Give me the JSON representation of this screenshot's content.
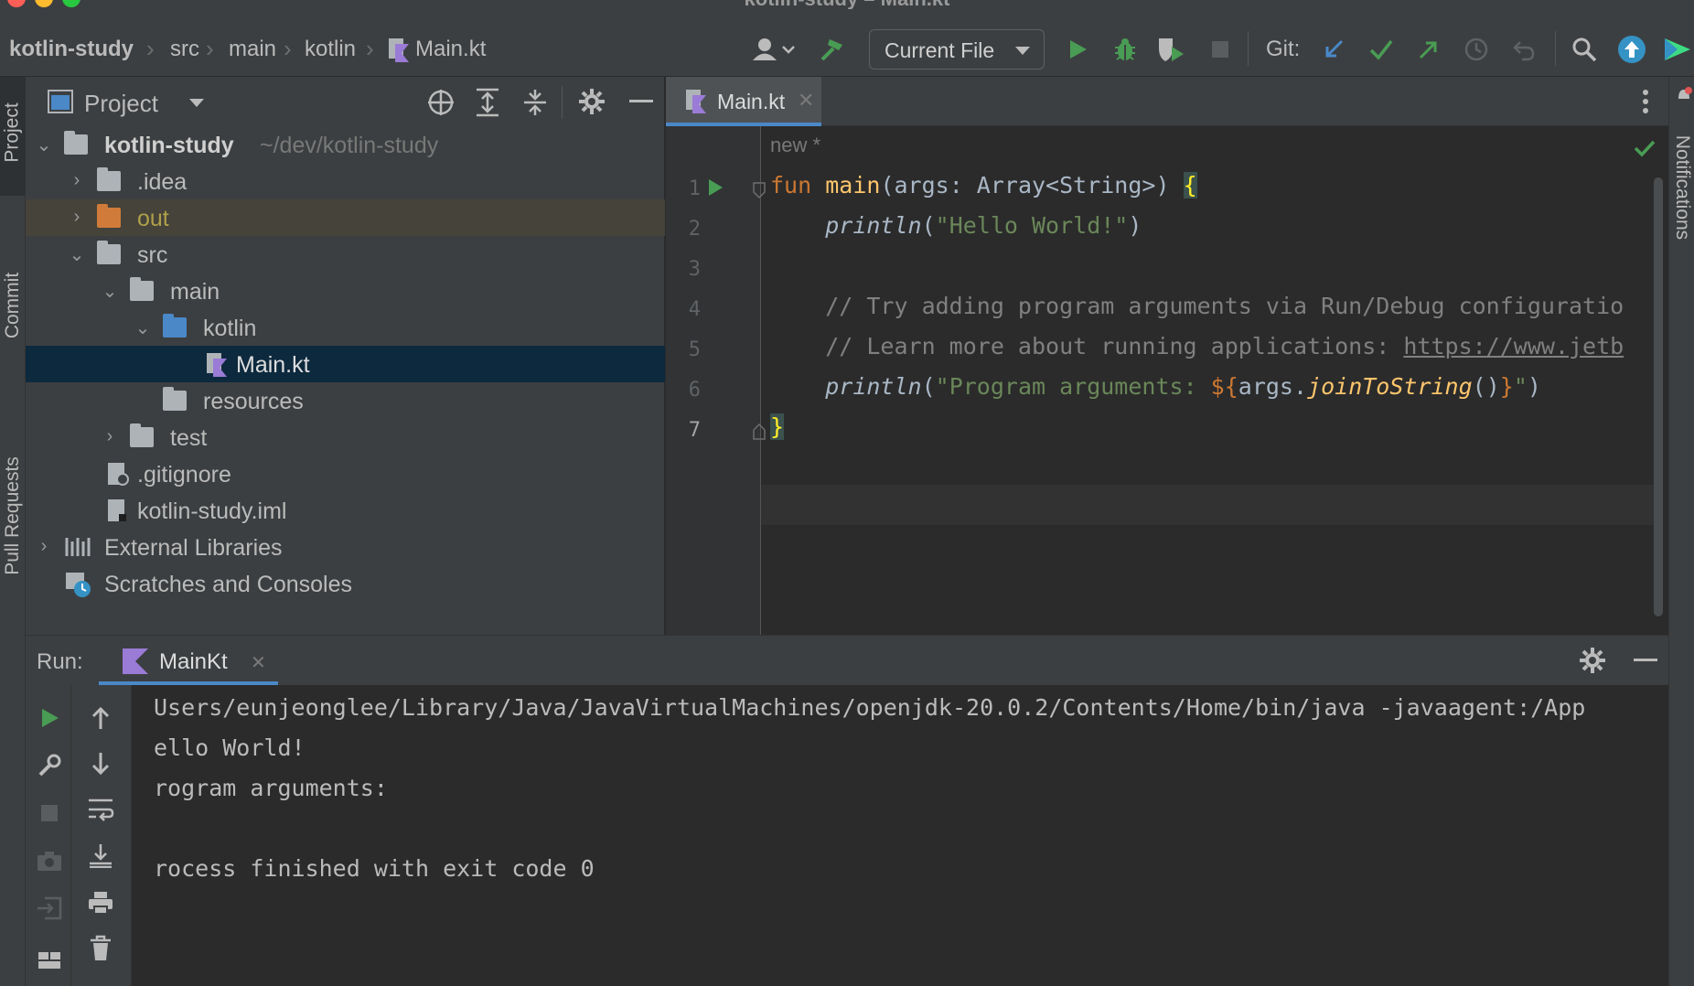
{
  "window": {
    "title": "kotlin-study – Main.kt"
  },
  "breadcrumbs": [
    "kotlin-study",
    "src",
    "main",
    "kotlin",
    "Main.kt"
  ],
  "toolbar": {
    "run_config": "Current File",
    "git_label": "Git:"
  },
  "left_strip": {
    "tabs": [
      "Project",
      "Commit",
      "Pull Requests"
    ]
  },
  "right_strip": {
    "tabs": [
      "Notifications"
    ]
  },
  "project": {
    "title": "Project",
    "root": {
      "name": "kotlin-study",
      "path": "~/dev/kotlin-study"
    },
    "items": [
      {
        "label": ".idea"
      },
      {
        "label": "out"
      },
      {
        "label": "src"
      },
      {
        "label": "main"
      },
      {
        "label": "kotlin"
      },
      {
        "label": "Main.kt"
      },
      {
        "label": "resources"
      },
      {
        "label": "test"
      },
      {
        "label": ".gitignore"
      },
      {
        "label": "kotlin-study.iml"
      },
      {
        "label": "External Libraries"
      },
      {
        "label": "Scratches and Consoles"
      }
    ]
  },
  "editor": {
    "tab_label": "Main.kt",
    "inlay_hint": "new *",
    "line_numbers": [
      "1",
      "2",
      "3",
      "4",
      "5",
      "6",
      "7"
    ],
    "code": {
      "l1_kw": "fun",
      "l1_fn": "main",
      "l1_rest": "(args: Array<String>) ",
      "l1_brace": "{",
      "l2_fn": "println",
      "l2_open": "(",
      "l2_str": "\"Hello World!\"",
      "l2_close": ")",
      "l4": "// Try adding program arguments via Run/Debug configuratio",
      "l5_text": "// Learn more about running applications: ",
      "l5_link": "https://www.jetb",
      "l6_fn": "println",
      "l6_open": "(",
      "l6_str": "\"Program arguments: ",
      "l6_tpl_open": "${",
      "l6_args": "args.",
      "l6_call": "joinToString",
      "l6_parens": "()",
      "l6_tpl_close": "}",
      "l6_str_end": "\"",
      "l6_close": ")",
      "l7": "}"
    }
  },
  "run": {
    "label": "Run:",
    "tab_label": "MainKt",
    "output": [
      "Users/eunjeonglee/Library/Java/JavaVirtualMachines/openjdk-20.0.2/Contents/Home/bin/java -javaagent:/App",
      "ello World!",
      "rogram arguments:",
      "",
      "rocess finished with exit code 0"
    ]
  },
  "colors": {
    "accent": "#4a88c7",
    "run_green": "#499c54",
    "selection": "#0d293e",
    "out_folder_bg": "#45433a"
  }
}
